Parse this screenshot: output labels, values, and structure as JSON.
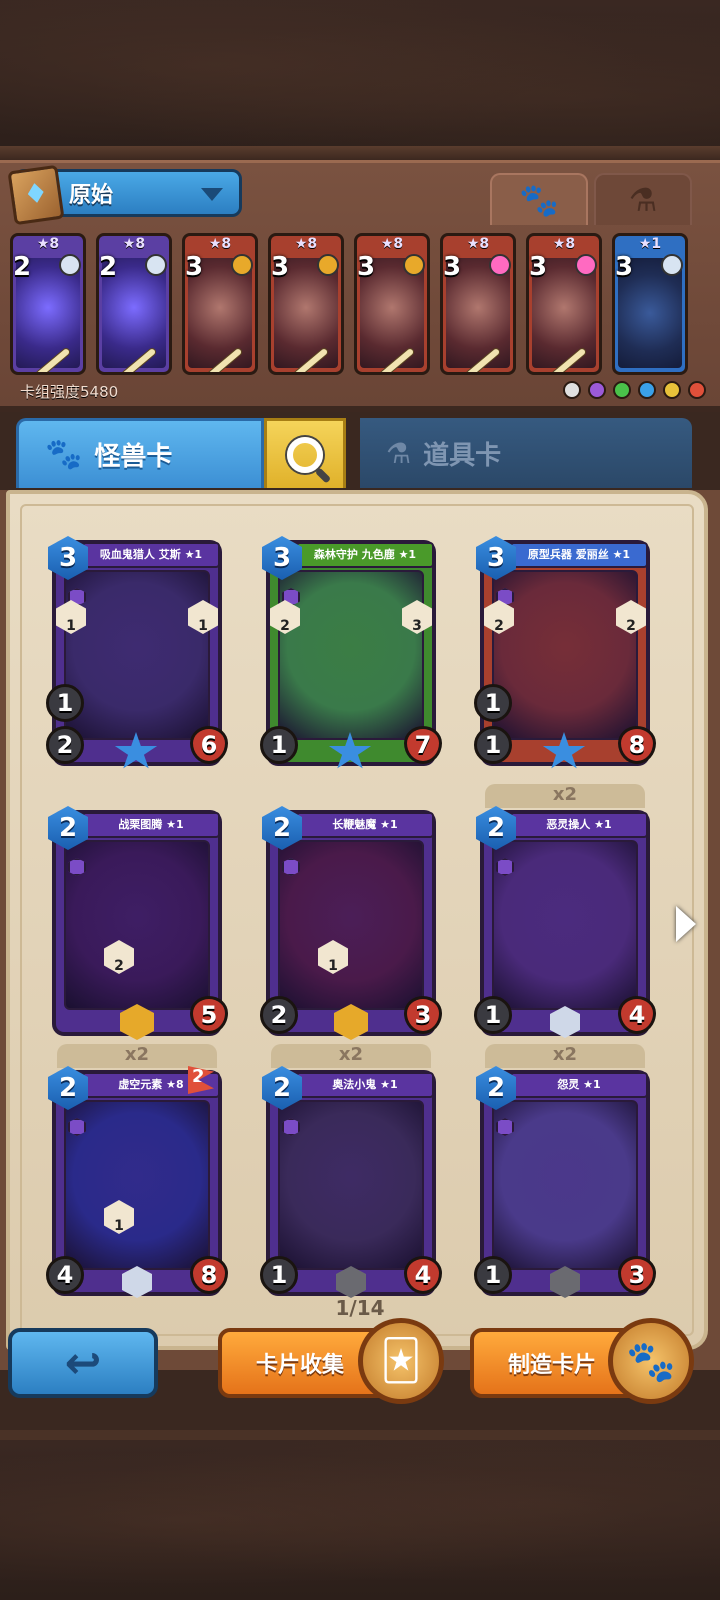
{
  "deck": {
    "name": "原始",
    "strength": "卡组强度5480",
    "cards": [
      {
        "stars": "★8",
        "cost": "2",
        "theme": "purple",
        "gem": "#d8e4f2"
      },
      {
        "stars": "★8",
        "cost": "2",
        "theme": "purple",
        "gem": "#d8e4f2"
      },
      {
        "stars": "★8",
        "cost": "3",
        "theme": "red",
        "gem": "#e8a92a"
      },
      {
        "stars": "★8",
        "cost": "3",
        "theme": "red",
        "gem": "#e8a92a"
      },
      {
        "stars": "★8",
        "cost": "3",
        "theme": "red",
        "gem": "#e8a92a"
      },
      {
        "stars": "★8",
        "cost": "3",
        "theme": "red",
        "gem": "#ff6ac1"
      },
      {
        "stars": "★8",
        "cost": "3",
        "theme": "red",
        "gem": "#ff6ac1"
      },
      {
        "stars": "★1",
        "cost": "3",
        "theme": "blue",
        "gem": "#d8e4f2"
      }
    ],
    "factions": [
      "#e0e0e0",
      "#9b5ad8",
      "#4ac24a",
      "#3aa0e8",
      "#e8c23a",
      "#e0503a"
    ]
  },
  "tabs": {
    "paw_icon": "paw-icon",
    "potion_icon": "potion-icon"
  },
  "categories": {
    "monster": "怪兽卡",
    "item": "道具卡"
  },
  "collection": {
    "page": "1/14",
    "cards": [
      {
        "name": "吸血鬼猎人 艾斯 ★1",
        "cost": "3",
        "atk": "2",
        "rng": "1",
        "hp": "6",
        "copies": "",
        "art": "#3a2a6a",
        "frame": "#4f2f8e",
        "banner": "#5a34a0",
        "skills": [
          "1",
          "1"
        ],
        "gem": "star"
      },
      {
        "name": "森林守护 九色鹿 ★1",
        "cost": "3",
        "atk": "1",
        "rng": "",
        "hp": "7",
        "copies": "",
        "art": "#3a7a4a",
        "frame": "#3f8a2e",
        "banner": "#4a9a2a",
        "skills": [
          "2",
          "3"
        ],
        "gem": "star"
      },
      {
        "name": "原型兵器 爱丽丝 ★1",
        "cost": "3",
        "atk": "1",
        "rng": "1",
        "hp": "8",
        "copies": "",
        "art": "#6a2a3a",
        "frame": "#a8402e",
        "banner": "#3a6ad0",
        "skills": [
          "2",
          "2"
        ],
        "gem": "star"
      },
      {
        "name": "战栗图腾 ★1",
        "cost": "2",
        "atk": "",
        "rng": "",
        "hp": "5",
        "copies": "",
        "art": "#3a1a5a",
        "frame": "#4f2f8e",
        "banner": "#5a34a0",
        "skills": [
          "2"
        ],
        "gem": "gold"
      },
      {
        "name": "长鞭魅魔 ★1",
        "cost": "2",
        "atk": "2",
        "rng": "",
        "hp": "3",
        "copies": "",
        "art": "#4a1a4a",
        "frame": "#4f2f8e",
        "banner": "#5a34a0",
        "skills": [
          "1"
        ],
        "gem": "gold"
      },
      {
        "name": "恶灵操人 ★1",
        "cost": "2",
        "atk": "1",
        "rng": "",
        "hp": "4",
        "copies": "x2",
        "art": "#4a2a7a",
        "frame": "#4f2f8e",
        "banner": "#5a34a0",
        "skills": [],
        "gem": "silver"
      },
      {
        "name": "虚空元素 ★8",
        "cost": "2",
        "atk": "4",
        "rng": "",
        "hp": "8",
        "copies": "x2",
        "art": "#2a2a8a",
        "frame": "#4f2f8e",
        "banner": "#5a34a0",
        "skills": [
          "1"
        ],
        "gem": "silver",
        "flag": "2"
      },
      {
        "name": "奥法小鬼 ★1",
        "cost": "2",
        "atk": "1",
        "rng": "",
        "hp": "4",
        "copies": "x2",
        "art": "#3a2a5a",
        "frame": "#4f2f8e",
        "banner": "#5a34a0",
        "skills": [],
        "gem": "dark"
      },
      {
        "name": "怨灵 ★1",
        "cost": "2",
        "atk": "1",
        "rng": "",
        "hp": "3",
        "copies": "x2",
        "art": "#4a3a8a",
        "frame": "#4f2f8e",
        "banner": "#5a34a0",
        "skills": [],
        "gem": "dark"
      }
    ]
  },
  "buttons": {
    "back": "↩",
    "collect": "卡片收集",
    "craft": "制造卡片"
  }
}
